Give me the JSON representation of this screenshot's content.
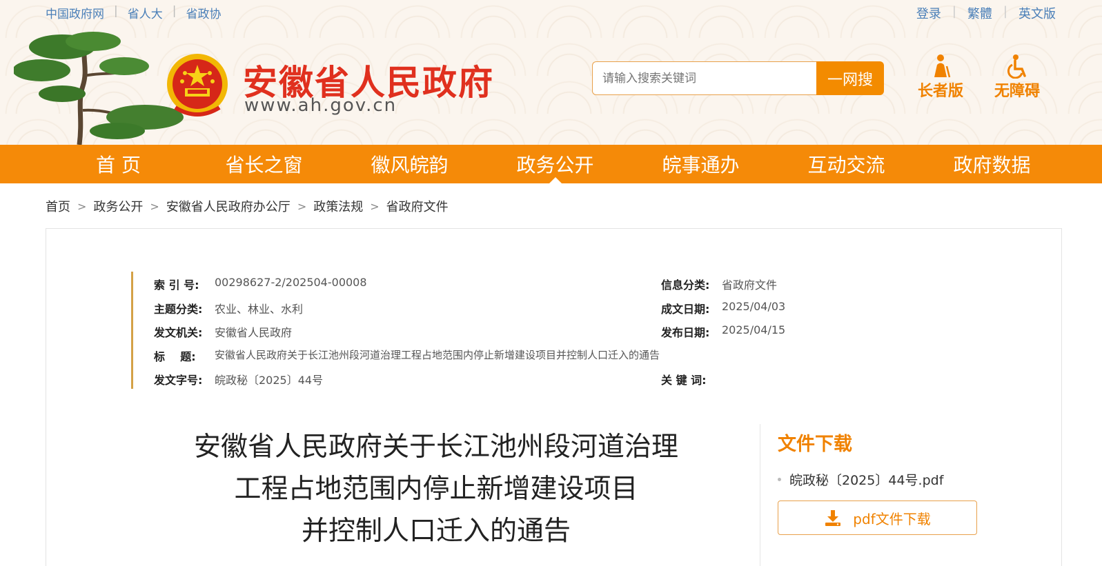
{
  "top_links": [
    "中国政府网",
    "省人大",
    "省政协"
  ],
  "top_right_links": [
    "登录",
    "繁體",
    "英文版"
  ],
  "site": {
    "title": "安徽省人民政府",
    "url": "www.ah.gov.cn"
  },
  "search": {
    "placeholder": "请输入搜索关键词",
    "button_label": "一网搜"
  },
  "modes": {
    "elderly_label": "长者版",
    "accessible_label": "无障碍"
  },
  "nav": [
    "首 页",
    "省长之窗",
    "徽风皖韵",
    "政务公开",
    "皖事通办",
    "互动交流",
    "政府数据"
  ],
  "nav_active_index": 3,
  "breadcrumb": [
    "首页",
    "政务公开",
    "安徽省人民政府办公厅",
    "政策法规",
    "省政府文件"
  ],
  "meta": {
    "index_label": "索 引 号:",
    "index_value": "00298627-2/202504-00008",
    "category_label": "信息分类:",
    "category_value": "省政府文件",
    "topic_label": "主题分类:",
    "topic_value": "农业、林业、水利",
    "written_label": "成文日期:",
    "written_value": "2025/04/03",
    "issuer_label": "发文机关:",
    "issuer_value": "安徽省人民政府",
    "published_label": "发布日期:",
    "published_value": "2025/04/15",
    "title_label": "标    题:",
    "title_value": "安徽省人民政府关于长江池州段河道治理工程占地范围内停止新增建设项目并控制人口迁入的通告",
    "docno_label": "发文字号:",
    "docno_value": "皖政秘〔2025〕44号",
    "keywords_label": "关 键 词:",
    "keywords_value": ""
  },
  "document": {
    "title_line1": "安徽省人民政府关于长江池州段河道治理",
    "title_line2": "工程占地范围内停止新增建设项目",
    "title_line3": "并控制人口迁入的通告"
  },
  "download": {
    "heading": "文件下载",
    "file_name": "皖政秘〔2025〕44号.pdf",
    "button_label": "pdf文件下载"
  },
  "colors": {
    "accent": "#f58a08",
    "title_red": "#e0301e",
    "link_blue": "#4a7fb8"
  }
}
